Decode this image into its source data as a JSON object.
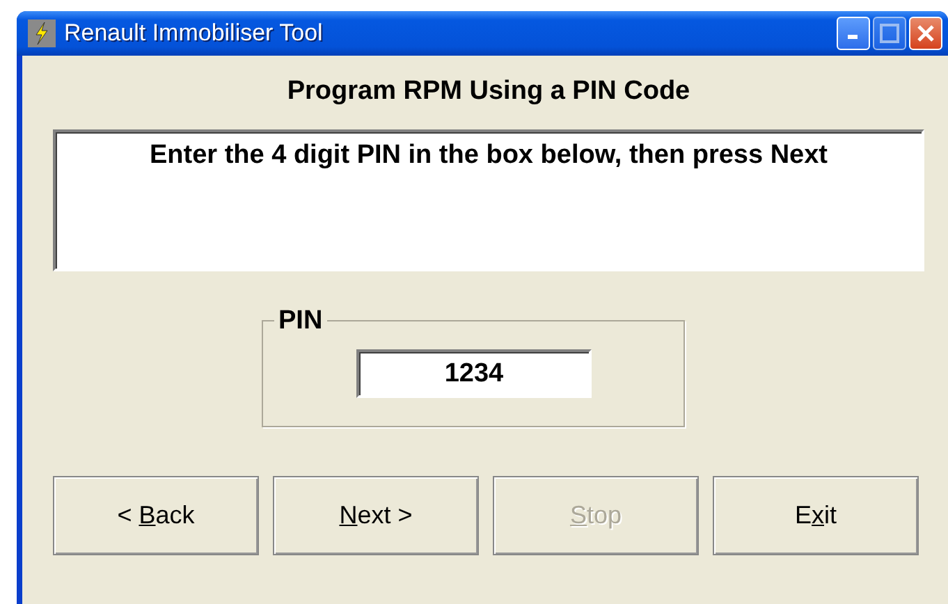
{
  "window": {
    "title": "Renault Immobiliser Tool"
  },
  "heading": "Program RPM Using a PIN Code",
  "message": "Enter the 4 digit PIN in the box below, then press Next",
  "pin_group": {
    "legend": "PIN",
    "value": "1234"
  },
  "buttons": [
    {
      "before": "< ",
      "mnemonic": "B",
      "after": "ack",
      "disabled": false
    },
    {
      "mnemonic": "N",
      "after": "ext >",
      "disabled": false
    },
    {
      "mnemonic": "S",
      "after": "top",
      "disabled": true
    },
    {
      "before": "E",
      "mnemonic": "x",
      "after": "it",
      "disabled": false
    }
  ]
}
